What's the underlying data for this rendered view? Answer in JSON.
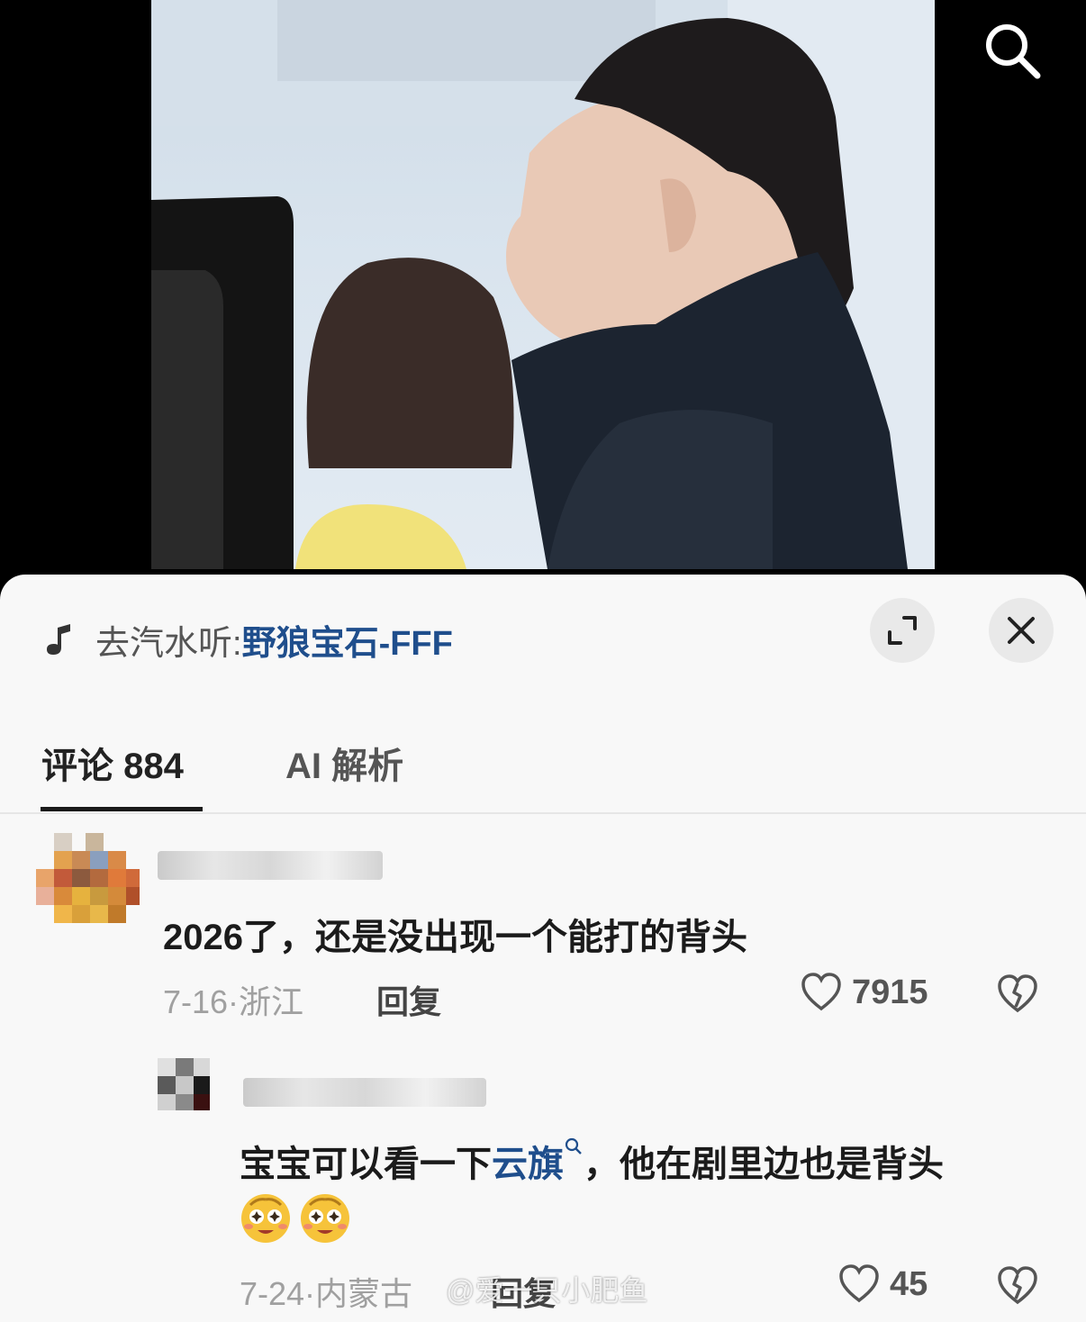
{
  "top_bar": {
    "search_icon": "search-icon"
  },
  "music": {
    "prefix": "去汽水听:",
    "song": "野狼宝石-FFF",
    "icon": "music-note-icon"
  },
  "sheet_controls": {
    "expand_icon": "expand-icon",
    "close_icon": "close-icon"
  },
  "tabs": [
    {
      "label": "评论 884",
      "active": true
    },
    {
      "label": "AI 解析",
      "active": false
    }
  ],
  "comments": [
    {
      "text": "2026了，还是没出现一个能打的背头",
      "meta": "7-16·浙江",
      "reply": "回复",
      "likes": "7915"
    }
  ],
  "replies": [
    {
      "text_before": "宝宝可以看一下",
      "link": "云旗",
      "text_after": "，他在剧里边也是背头",
      "meta": "7-24·内蒙古",
      "reply": "回复",
      "likes": "45"
    }
  ],
  "watermark": "@爱一只小肥鱼",
  "colors": {
    "link": "#1f4e8c",
    "sheet_bg": "#f8f8f8",
    "meta": "#a0a0a0"
  }
}
